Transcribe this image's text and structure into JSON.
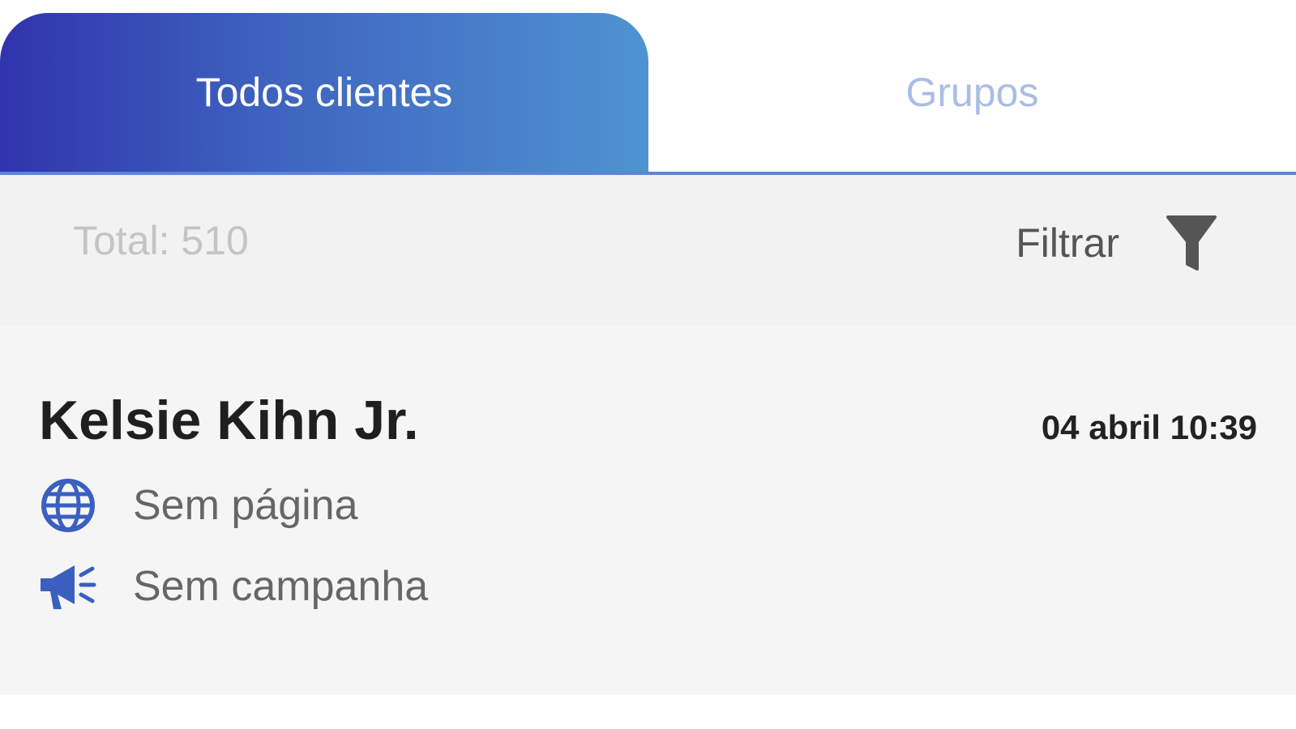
{
  "tabs": [
    {
      "label": "Todos clientes",
      "active": true
    },
    {
      "label": "Grupos",
      "active": false
    }
  ],
  "toolbar": {
    "total_text": "Total: 510",
    "filter_label": "Filtrar",
    "filter_icon": "filter-icon"
  },
  "client": {
    "name": "Kelsie Kihn Jr.",
    "date": "04 abril 10:39",
    "page_icon": "globe-icon",
    "page_text": "Sem página",
    "campaign_icon": "megaphone-icon",
    "campaign_text": "Sem campanha"
  },
  "colors": {
    "accent": "#3a5fc0",
    "tab_gradient_start": "#3034ad",
    "tab_gradient_end": "#4f93d1",
    "inactive_tab_text": "#a9bde6",
    "icon_blue": "#3a5fc0"
  }
}
